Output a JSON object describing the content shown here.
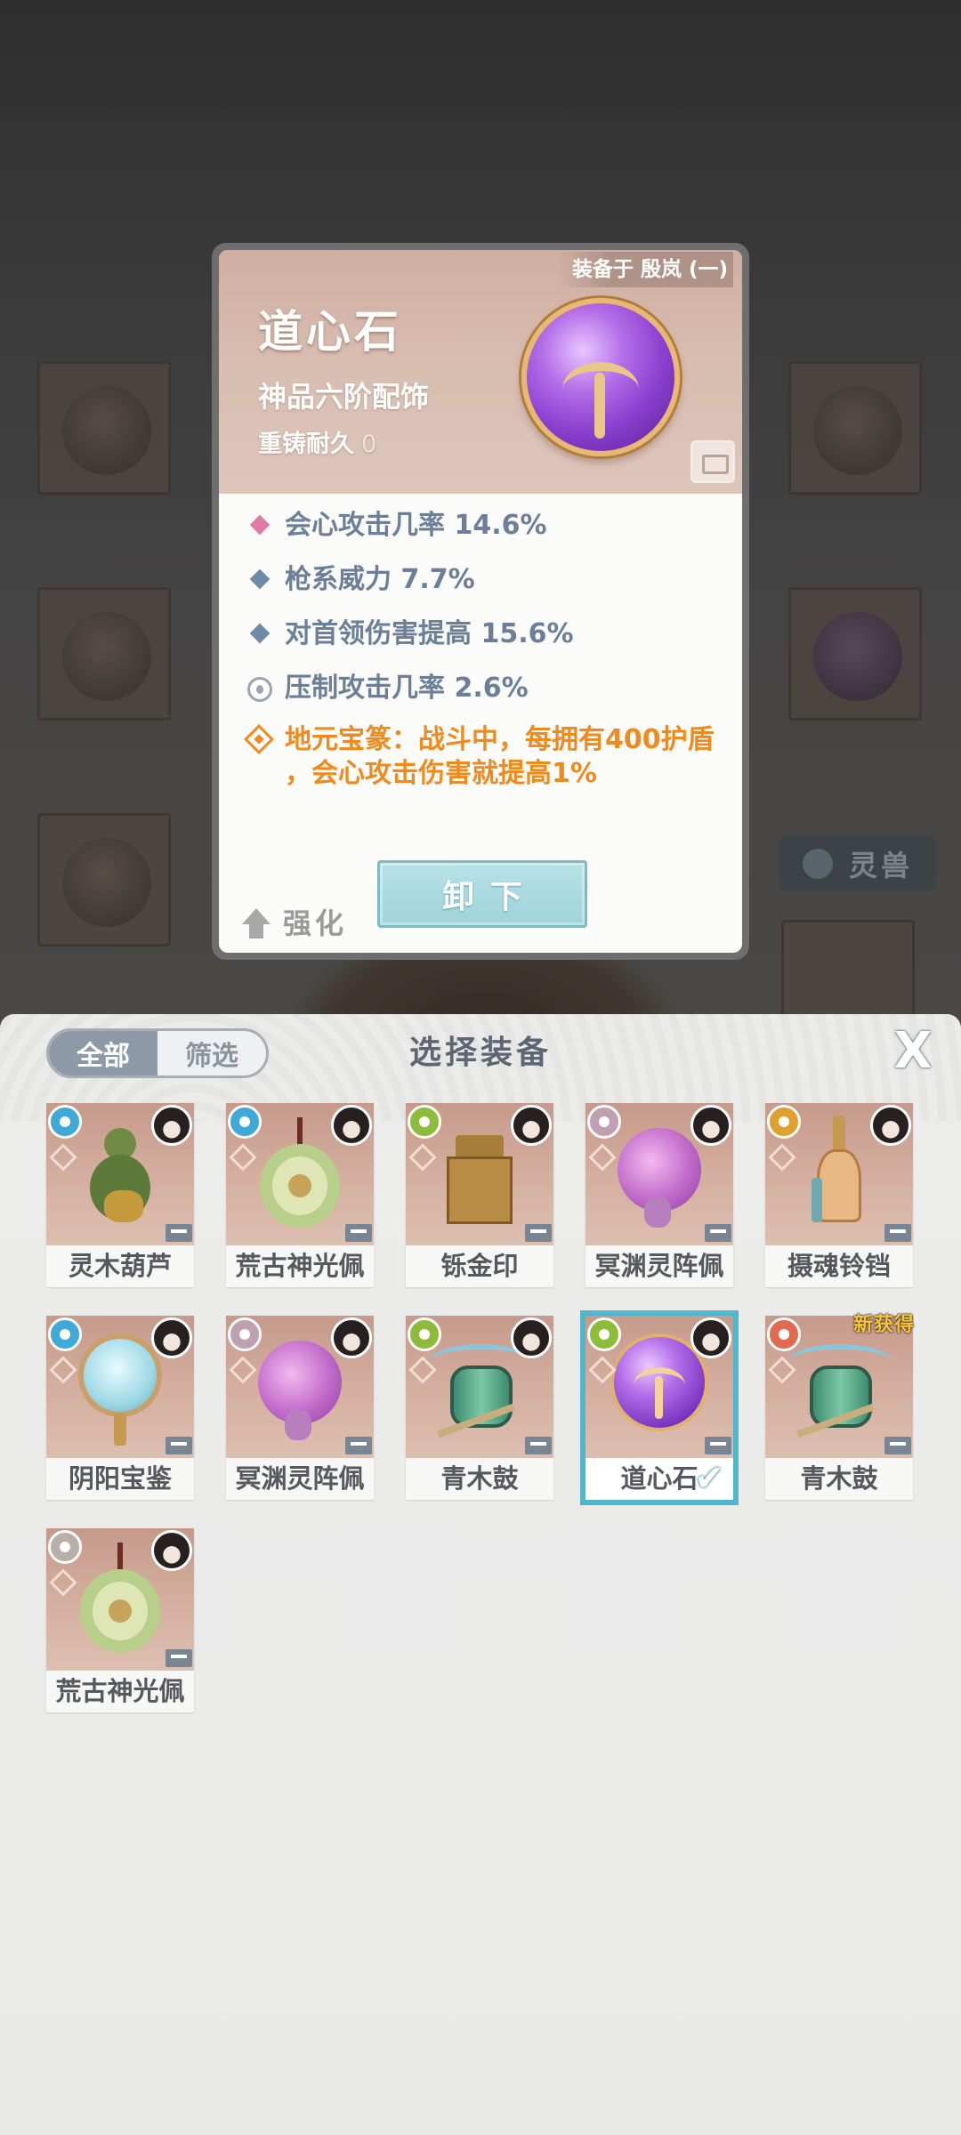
{
  "colors": {
    "accent_teal": "#4fb6cc",
    "stat_blue": "#6b7f99",
    "special_orange": "#f08a1c",
    "crit_pink": "#e07aa6",
    "new_gold": "#f4c542"
  },
  "background": {
    "beast_tab_label": "灵兽"
  },
  "detail": {
    "equipped_label": "装备于 殷岚 (一)",
    "name": "道心石",
    "grade": "神品六阶配饰",
    "durability_label": "重铸耐久",
    "durability_value": "0",
    "stats": [
      {
        "icon": "pink-diamond-icon",
        "text": "会心攻击几率 14.6%"
      },
      {
        "icon": "blue-diamond-icon",
        "text": "枪系威力 7.7%"
      },
      {
        "icon": "blue-diamond-icon",
        "text": "对首领伤害提高 15.6%"
      },
      {
        "icon": "suppress-flame-icon",
        "text": "压制攻击几率 2.6%"
      }
    ],
    "special_effect_line1": "地元宝篆：战斗中，每拥有400护盾",
    "special_effect_line2": "，会心攻击伤害就提高1%",
    "enhance_label": "强化",
    "unequip_label": "卸下"
  },
  "sheet": {
    "tab_all": "全部",
    "tab_filter": "筛选",
    "title": "选择装备",
    "close_label": "X",
    "items": [
      {
        "name": "灵木葫芦",
        "element_color": "#3fa9d8",
        "shape": "gourd",
        "selected": false,
        "new": false
      },
      {
        "name": "荒古神光佩",
        "element_color": "#3fa9d8",
        "shape": "pendant",
        "selected": false,
        "new": false
      },
      {
        "name": "铄金印",
        "element_color": "#8dbb3a",
        "shape": "seal",
        "selected": false,
        "new": false
      },
      {
        "name": "冥渊灵阵佩",
        "element_color": "#c0a0b0",
        "shape": "mist",
        "selected": false,
        "new": false
      },
      {
        "name": "摄魂铃铛",
        "element_color": "#e0a030",
        "shape": "bell",
        "selected": false,
        "new": false
      },
      {
        "name": "阴阳宝鉴",
        "element_color": "#3fa9d8",
        "shape": "mirror",
        "selected": false,
        "new": false
      },
      {
        "name": "冥渊灵阵佩",
        "element_color": "#c0a0b0",
        "shape": "mist",
        "selected": false,
        "new": false
      },
      {
        "name": "青木鼓",
        "element_color": "#8dbb3a",
        "shape": "drum",
        "selected": false,
        "new": false
      },
      {
        "name": "道心石",
        "element_color": "#8dbb3a",
        "shape": "orb",
        "selected": true,
        "new": false
      },
      {
        "name": "青木鼓",
        "element_color": "#e06a50",
        "shape": "drum",
        "selected": false,
        "new": true,
        "new_label": "新获得"
      },
      {
        "name": "荒古神光佩",
        "element_color": "#b8b0a8",
        "shape": "pendant",
        "selected": false,
        "new": false
      }
    ],
    "selected_check": "✔"
  }
}
